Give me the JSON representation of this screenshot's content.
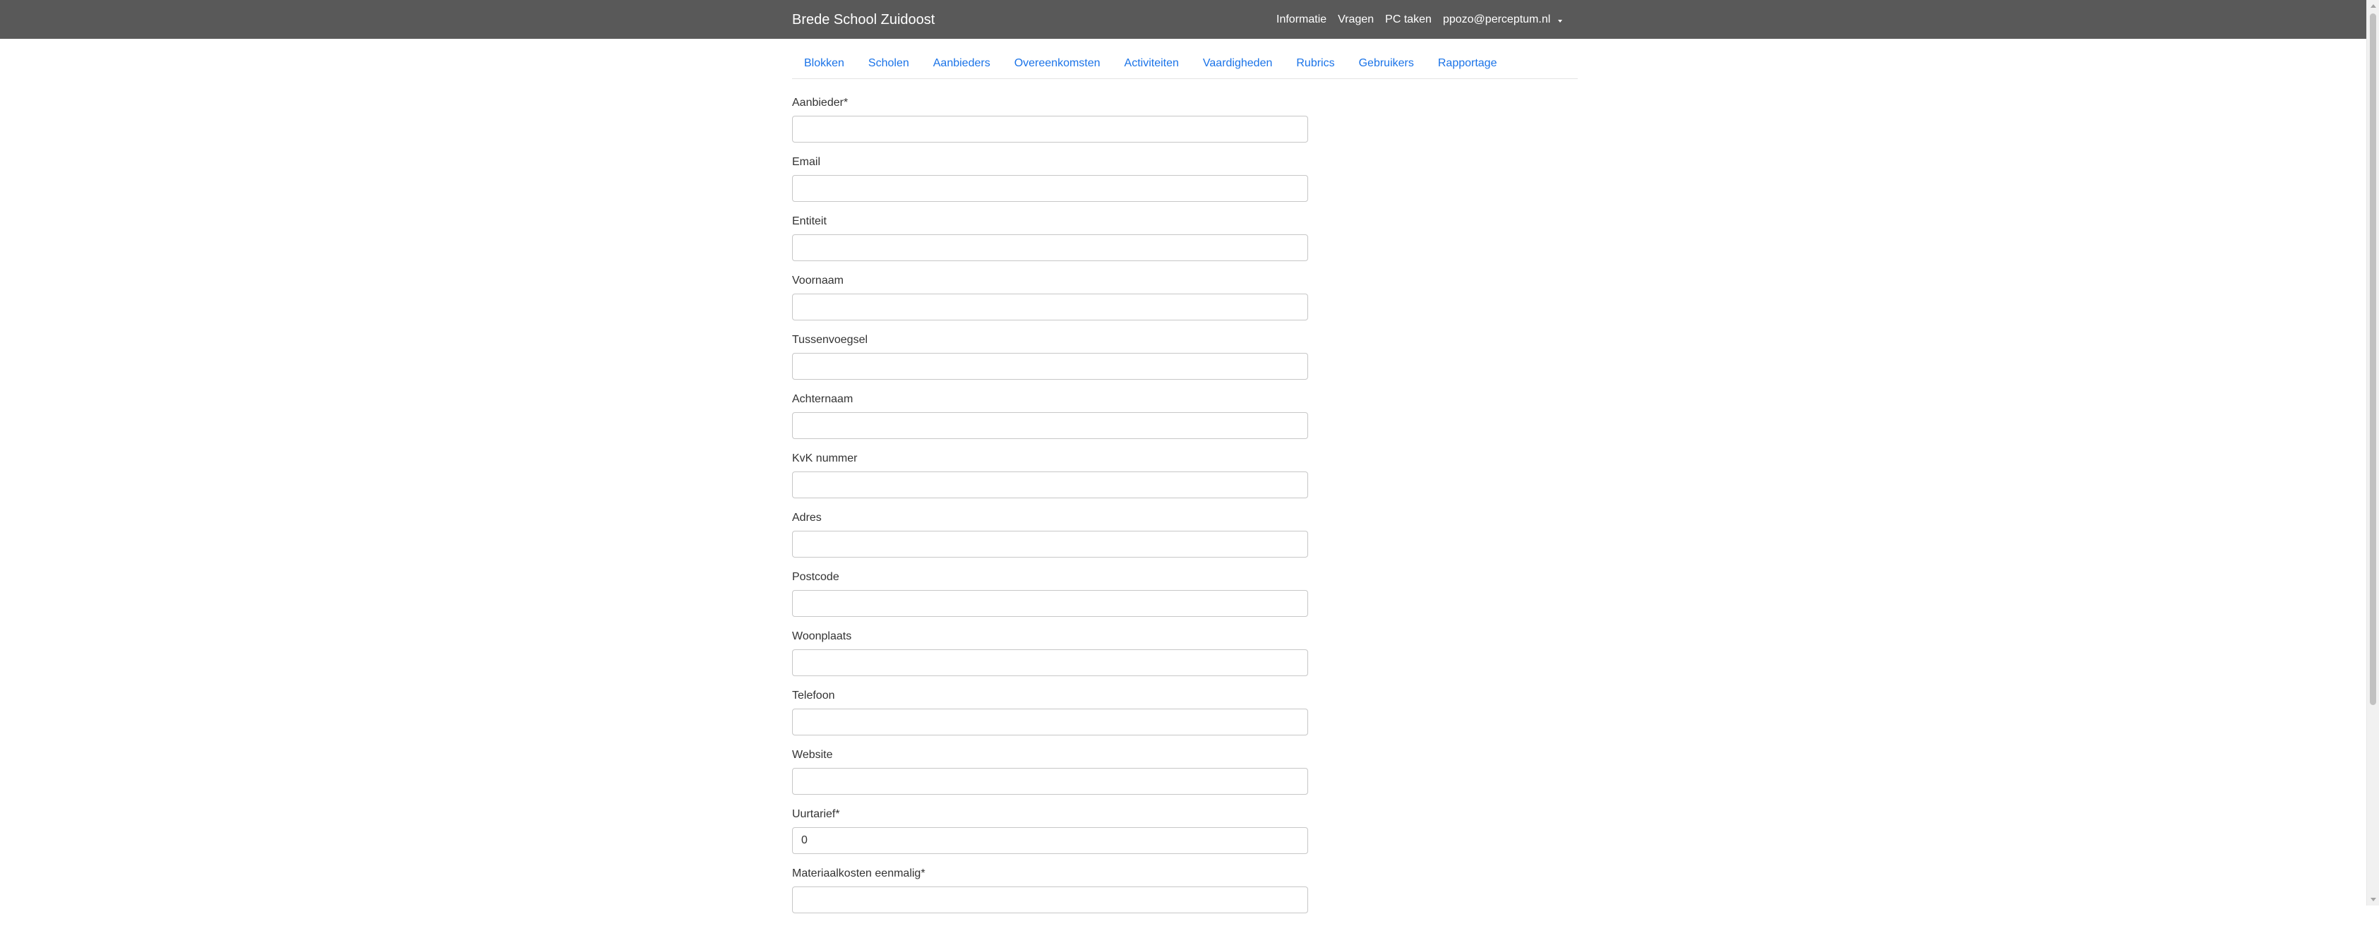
{
  "header": {
    "brand": "Brede School Zuidoost",
    "links": [
      "Informatie",
      "Vragen",
      "PC taken",
      "ppozo@perceptum.nl"
    ],
    "background": "#595959"
  },
  "tabs": [
    "Blokken",
    "Scholen",
    "Aanbieders",
    "Overeenkomsten",
    "Activiteiten",
    "Vaardigheden",
    "Rubrics",
    "Gebruikers",
    "Rapportage"
  ],
  "form": {
    "fields": [
      {
        "label": "Aanbieder*",
        "value": ""
      },
      {
        "label": "Email",
        "value": ""
      },
      {
        "label": "Entiteit",
        "value": ""
      },
      {
        "label": "Voornaam",
        "value": ""
      },
      {
        "label": "Tussenvoegsel",
        "value": ""
      },
      {
        "label": "Achternaam",
        "value": ""
      },
      {
        "label": "KvK nummer",
        "value": ""
      },
      {
        "label": "Adres",
        "value": ""
      },
      {
        "label": "Postcode",
        "value": ""
      },
      {
        "label": "Woonplaats",
        "value": ""
      },
      {
        "label": "Telefoon",
        "value": ""
      },
      {
        "label": "Website",
        "value": ""
      },
      {
        "label": "Uurtarief*",
        "value": "0"
      },
      {
        "label": "Materiaalkosten eenmalig*",
        "value": ""
      }
    ]
  },
  "icons": {
    "dropdown": "caret-down-icon"
  },
  "colors": {
    "link": "#1a73e8",
    "navbar": "#595959"
  }
}
